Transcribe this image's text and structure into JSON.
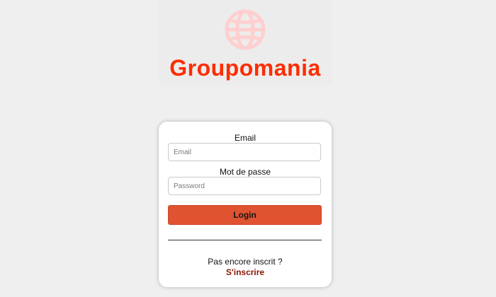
{
  "brand": {
    "icon": "globe-icon",
    "name": "Groupomania",
    "color": "#fd2d01",
    "icon_color": "#ffd1d1"
  },
  "form": {
    "email_label": "Email",
    "email_placeholder": "Email",
    "email_value": "",
    "password_label": "Mot de passe",
    "password_placeholder": "Password",
    "password_value": "",
    "login_label": "Login",
    "login_color": "#e05331"
  },
  "signup": {
    "prompt": "Pas encore inscrit ?",
    "link_label": "S'inscrire",
    "link_color": "#8a1400"
  }
}
